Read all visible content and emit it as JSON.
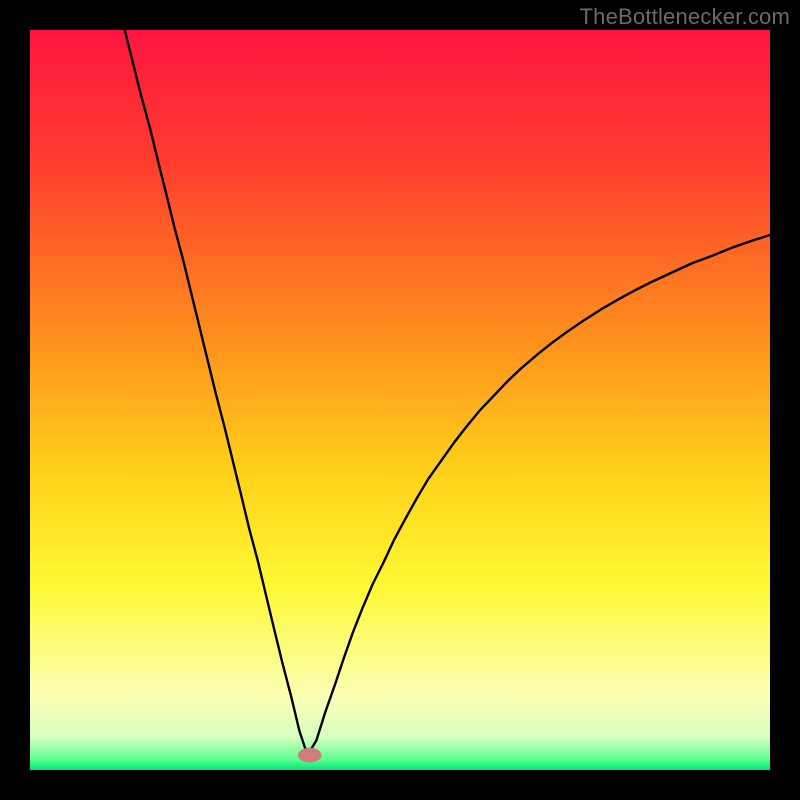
{
  "watermark": {
    "text": "TheBottlenecker.com"
  },
  "chart_data": {
    "type": "line",
    "title": "",
    "xlabel": "",
    "ylabel": "",
    "xlim": [
      0,
      100
    ],
    "ylim": [
      0,
      100
    ],
    "background_gradient": {
      "stops": [
        {
          "offset": 0,
          "color": "#ff1540"
        },
        {
          "offset": 0.18,
          "color": "#ff3d2f"
        },
        {
          "offset": 0.4,
          "color": "#ff8a1d"
        },
        {
          "offset": 0.6,
          "color": "#ffd21a"
        },
        {
          "offset": 0.75,
          "color": "#fff833"
        },
        {
          "offset": 0.9,
          "color": "#faffb4"
        },
        {
          "offset": 0.955,
          "color": "#d8ffc0"
        },
        {
          "offset": 0.985,
          "color": "#60ff90"
        },
        {
          "offset": 1.0,
          "color": "#00e47a"
        }
      ]
    },
    "minimum_x": 37.5,
    "marker": {
      "x": 37.8,
      "y": 2.0,
      "rx": 1.6,
      "ry": 1.0,
      "color": "#cf7d7c"
    },
    "curve": {
      "stroke": "#000000",
      "stroke_width": 2.4,
      "points": [
        {
          "x": 12.8,
          "y": 100.0
        },
        {
          "x": 13.9,
          "y": 95.6
        },
        {
          "x": 15.0,
          "y": 91.2
        },
        {
          "x": 16.2,
          "y": 86.8
        },
        {
          "x": 17.3,
          "y": 82.3
        },
        {
          "x": 18.4,
          "y": 77.9
        },
        {
          "x": 19.5,
          "y": 73.4
        },
        {
          "x": 20.7,
          "y": 68.9
        },
        {
          "x": 21.8,
          "y": 64.4
        },
        {
          "x": 22.9,
          "y": 59.9
        },
        {
          "x": 24.0,
          "y": 55.4
        },
        {
          "x": 25.1,
          "y": 50.9
        },
        {
          "x": 26.3,
          "y": 46.3
        },
        {
          "x": 27.4,
          "y": 41.8
        },
        {
          "x": 28.5,
          "y": 37.3
        },
        {
          "x": 29.6,
          "y": 32.7
        },
        {
          "x": 30.8,
          "y": 28.2
        },
        {
          "x": 31.9,
          "y": 23.6
        },
        {
          "x": 33.0,
          "y": 19.0
        },
        {
          "x": 34.1,
          "y": 14.5
        },
        {
          "x": 35.3,
          "y": 9.9
        },
        {
          "x": 36.4,
          "y": 5.3
        },
        {
          "x": 37.5,
          "y": 2.0
        },
        {
          "x": 38.7,
          "y": 4.0
        },
        {
          "x": 39.9,
          "y": 7.8
        },
        {
          "x": 41.2,
          "y": 11.5
        },
        {
          "x": 42.4,
          "y": 15.1
        },
        {
          "x": 43.6,
          "y": 18.5
        },
        {
          "x": 44.9,
          "y": 21.8
        },
        {
          "x": 46.3,
          "y": 25.1
        },
        {
          "x": 47.8,
          "y": 28.1
        },
        {
          "x": 49.2,
          "y": 31.1
        },
        {
          "x": 50.7,
          "y": 33.9
        },
        {
          "x": 52.2,
          "y": 36.6
        },
        {
          "x": 53.8,
          "y": 39.3
        },
        {
          "x": 55.5,
          "y": 41.7
        },
        {
          "x": 57.2,
          "y": 44.1
        },
        {
          "x": 58.9,
          "y": 46.3
        },
        {
          "x": 60.7,
          "y": 48.5
        },
        {
          "x": 62.6,
          "y": 50.5
        },
        {
          "x": 64.5,
          "y": 52.5
        },
        {
          "x": 66.4,
          "y": 54.3
        },
        {
          "x": 68.5,
          "y": 56.1
        },
        {
          "x": 70.5,
          "y": 57.7
        },
        {
          "x": 72.7,
          "y": 59.3
        },
        {
          "x": 74.9,
          "y": 60.8
        },
        {
          "x": 77.1,
          "y": 62.2
        },
        {
          "x": 79.5,
          "y": 63.6
        },
        {
          "x": 81.9,
          "y": 64.9
        },
        {
          "x": 84.3,
          "y": 66.1
        },
        {
          "x": 86.9,
          "y": 67.3
        },
        {
          "x": 89.5,
          "y": 68.5
        },
        {
          "x": 92.2,
          "y": 69.5
        },
        {
          "x": 94.9,
          "y": 70.6
        },
        {
          "x": 97.8,
          "y": 71.6
        },
        {
          "x": 100.0,
          "y": 72.3
        }
      ]
    }
  }
}
